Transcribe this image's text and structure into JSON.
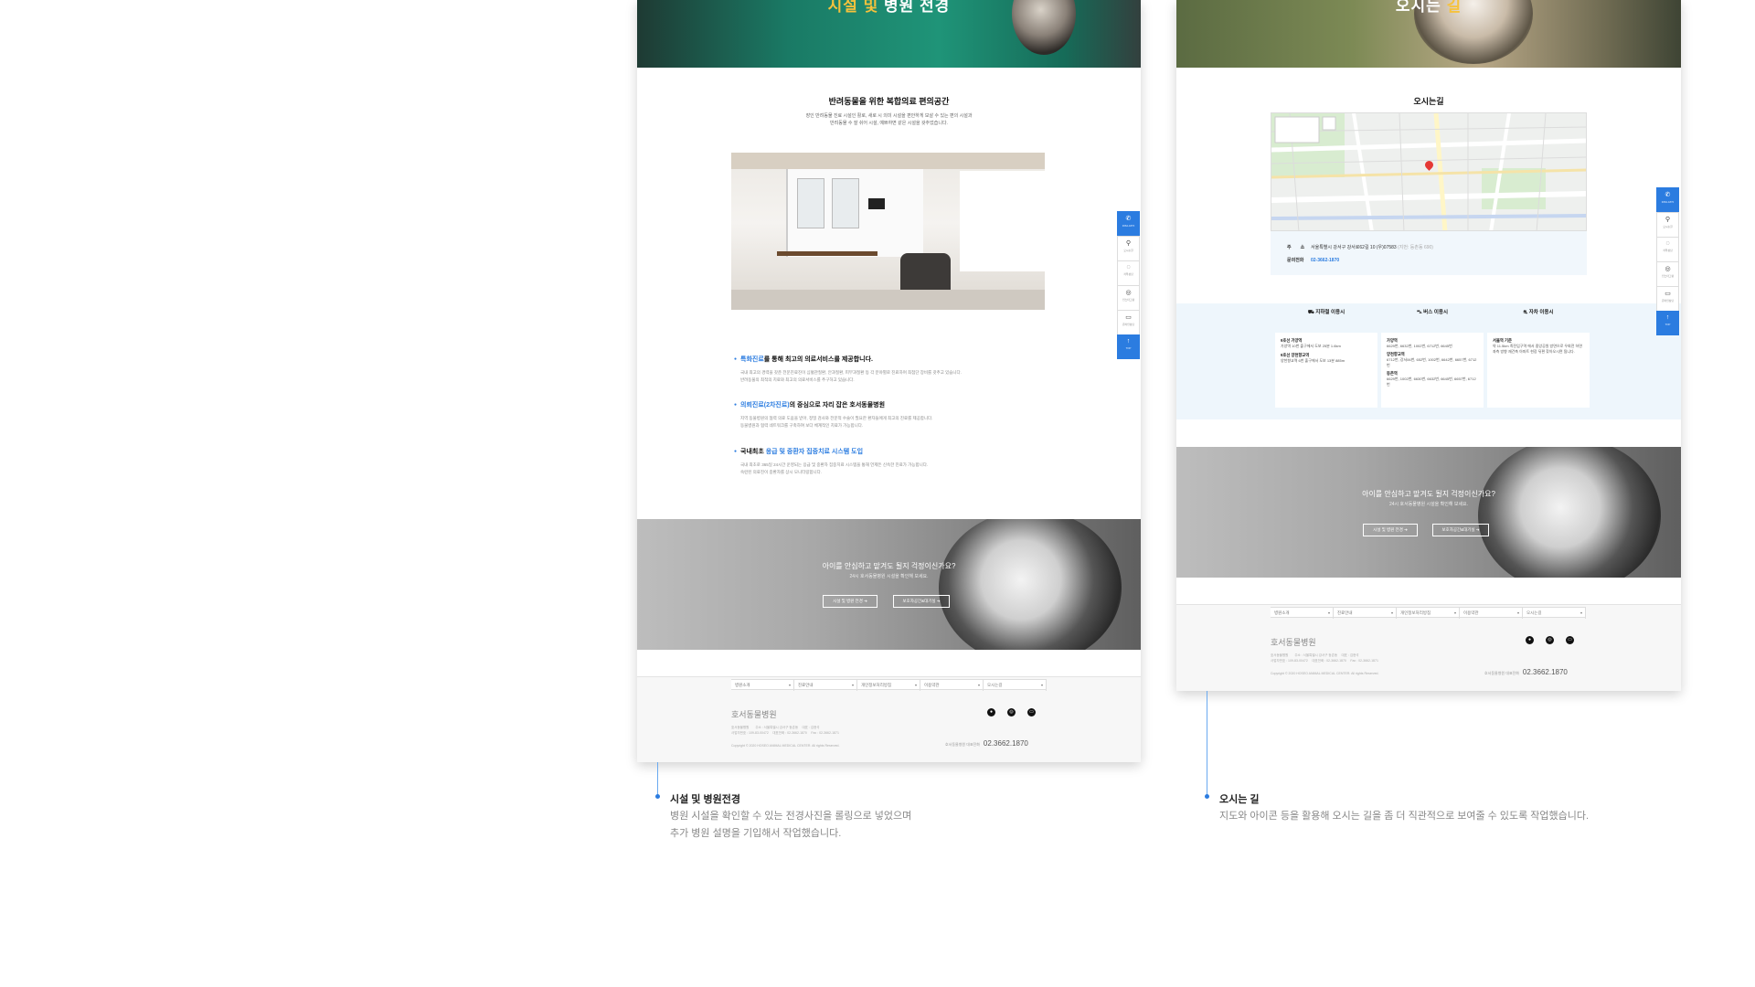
{
  "colors": {
    "accent": "#2b7ce0",
    "highlight": "#f6c23c"
  },
  "facility_page": {
    "hero_title_prefix": "시설",
    "hero_title_and": " 및 ",
    "hero_title_suffix": "병원 전경",
    "section_title": "반려동물을 위한 복합의료 편의공간",
    "section_desc_1": "장인 반려동물 진료 시설인 활로, 새로 시 의미 시설을 편안하게 보살 수 있는 편의 시설과",
    "section_desc_2": "반려동물 수 잘 쉬어 시설, 예쁘하면 같은 시설을 갖추었습니다.",
    "features": [
      {
        "pre": "",
        "blue": "특화진료",
        "post": "를 통해 최고의 의료서비스를 제공합니다.",
        "desc_1": "국내 최고의 경력을 갖춘 전문진료진이 심혈관질환, 안과질환, 피부과질환 등 각 분야별로 진료하며 최첨단 장비를 갖추고 있습니다.",
        "desc_2": "반려동물의 최적의 치료와 최고의 의료서비스를 추구하고 있습니다."
      },
      {
        "pre": "",
        "blue": "의뢰진료(2차진료)",
        "post": "의 중심으로 자리 잡은 호서동물병원",
        "desc_1": "지역 동물병원의 협력 의료 도움을 받아, 정밀 검사와 전문적 수술이 필요한 환자들에게 최고의 진료를 제공합니다.",
        "desc_2": "동물병원과 협력 네트워크를 구축하여 보다 체계적인 치료가 가능합니다."
      },
      {
        "pre": "국내최초 ",
        "blue": "응급 및 중환자 집중치료 시스템 도입",
        "post": "",
        "desc_1": "국내 최초로 365일 24시간 운영되는 응급 및 중환자 집중치료 시스템을 통해 언제든 신속한 진료가 가능합니다.",
        "desc_2": "숙련된 의료진이 중환자를 상시 모니터링합니다."
      }
    ],
    "cta_title": "아이를 안심하고 맡겨도 될지 걱정이신가요?",
    "cta_sub": "24시 호서동물병원 시설을 확인해 보세요.",
    "cta_btn_1": "시설 및 병원 전경 ➔",
    "cta_btn_2": "보호자공간&대기실 ➔"
  },
  "directions_page": {
    "hero_title_prefix": "오시는",
    "hero_title_suffix": " 길",
    "section_title": "오시는길",
    "address_label": "주　　소",
    "address_value": "서울특별시 강서구 강서로62길 10 (우)07583",
    "address_note": "(지번: 등촌동 690)",
    "phone_label": "문의전화",
    "phone_value": "02-3662-1870",
    "transport": [
      {
        "title": "지하철 이용시",
        "lines": [
          {
            "name": "9호선 가양역",
            "text": "가양역 10번 출구에서 도보 25분 1.6km"
          },
          {
            "name": "9호선 양천향교역",
            "text": "양천향교역 6번 출구에서 도보 13분 885m"
          }
        ]
      },
      {
        "title": "버스 이용시",
        "lines": [
          {
            "name": "가양역",
            "text": "6629번, 6632번, 1002번, 6712번, 6645번"
          },
          {
            "name": "양천향교역",
            "text": "6712번, 강서06번, 652번, 1002번, 6642번, 6657번, 6712번"
          },
          {
            "name": "등촌역",
            "text": "6629번, 1002번, 6630번, 6632번, 6645번, 6657번, 6712번"
          }
        ]
      },
      {
        "title": "자차 이용시",
        "lines": [
          {
            "name": "서울역 기준",
            "text": "약 11.5km 죽전입구역 에서 중앙공원 방면으로 우회전 하면 좌측 방향 재건축 아파트 현장 뒤편 찾아오시면 됩니다."
          }
        ]
      }
    ],
    "cta_title": "아이를 안심하고 맡겨도 될지 걱정이신가요?",
    "cta_sub": "24시 호서동물병원 시설을 확인해 보세요.",
    "cta_btn_1": "시설 및 병원 전경 ➔",
    "cta_btn_2": "보호자공간&대기실 ➔"
  },
  "footer": {
    "nav": [
      "병원소개",
      "진료안내",
      "개인정보처리방침",
      "이용약관",
      "오시는길"
    ],
    "logo": "호서동물병원",
    "info_1": "호서동물병원　　주소 : 서울특별시 강서구 등촌동 　대표 : 김현석",
    "info_2": "사업자번호 : 109-83-00472 　대표전화 : 02-3662-1870 　Fax : 02-3662-1871",
    "copyright": "Copyright © 2020 HOSEO ANIMAL MEDICAL CENTER. All rights Reserved.",
    "phone_label": "호서동물병원 대표전화",
    "phone": "02.3662.1870"
  },
  "quickbar": [
    {
      "icon": "phone",
      "label": "3662-1870"
    },
    {
      "icon": "map-pin",
      "label": "오시는길"
    },
    {
      "icon": "chat",
      "label": "카톡상담"
    },
    {
      "icon": "instagram",
      "label": "인스타그램"
    },
    {
      "icon": "monitor",
      "label": "온라인상담"
    },
    {
      "icon": "arrow-up",
      "label": "TOP"
    }
  ],
  "captions": [
    {
      "title": "시설 및 병원전경",
      "desc_1": "병원 시설을 확인할 수 있는 전경사진을 롤링으로 넣었으며",
      "desc_2": "추가 병원 설명을 기입해서 작업했습니다."
    },
    {
      "title": "오시는 길",
      "desc_1": "지도와 아이콘 등을 활용해 오시는 길을 좀 더 직관적으로 보여줄 수 있도록 작업했습니다."
    }
  ]
}
